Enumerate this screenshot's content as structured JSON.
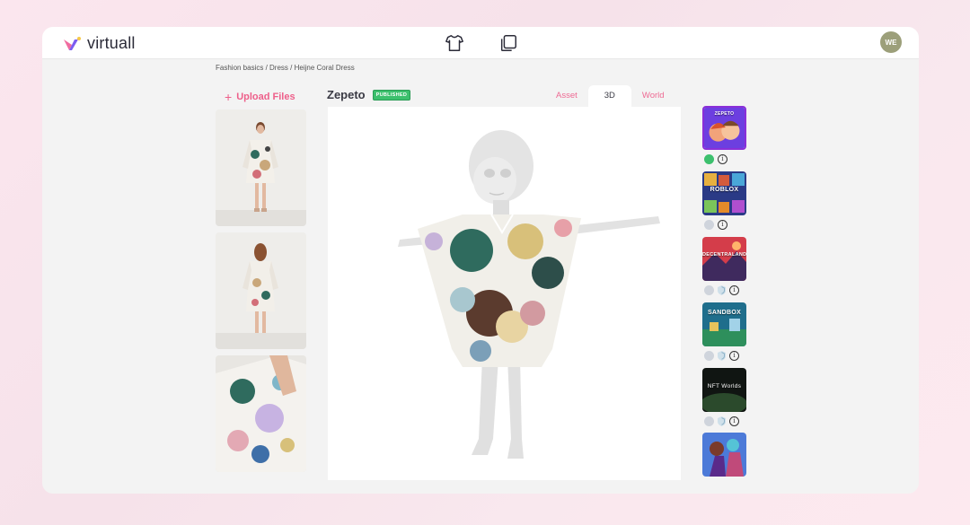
{
  "app": {
    "name": "virtuall"
  },
  "header": {
    "icons": [
      "tshirt-icon",
      "copy-icon"
    ],
    "avatar_initials": "WE"
  },
  "breadcrumb": "Fashion basics / Dress / Heijne Coral Dress",
  "upload": {
    "label": "Upload Files",
    "icon": "plus-icon"
  },
  "thumbnails": [
    {
      "name": "front-view"
    },
    {
      "name": "back-view"
    },
    {
      "name": "detail-view"
    }
  ],
  "platform": {
    "name": "Zepeto",
    "status": "PUBLISHED"
  },
  "tabs": [
    {
      "label": "Asset",
      "active": false
    },
    {
      "label": "3D",
      "active": true
    },
    {
      "label": "World",
      "active": false
    }
  ],
  "platforms": [
    {
      "name": "zepeto",
      "label": "ZEPETO",
      "status": "published",
      "has_shield": false
    },
    {
      "name": "roblox",
      "label": "ROBLOX",
      "status": "inactive",
      "has_shield": false
    },
    {
      "name": "decentraland",
      "label": "DECENTRALAND",
      "status": "inactive",
      "has_shield": true
    },
    {
      "name": "sandbox",
      "label": "SANDBOX",
      "status": "inactive",
      "has_shield": true
    },
    {
      "name": "nft-worlds",
      "label": "NFT Worlds",
      "status": "inactive",
      "has_shield": true
    },
    {
      "name": "game-six",
      "label": "",
      "status": "",
      "has_shield": false
    }
  ],
  "colors": {
    "accent": "#ee5f8a",
    "published": "#3cc06d",
    "selected_border": "#8a2fd8"
  }
}
